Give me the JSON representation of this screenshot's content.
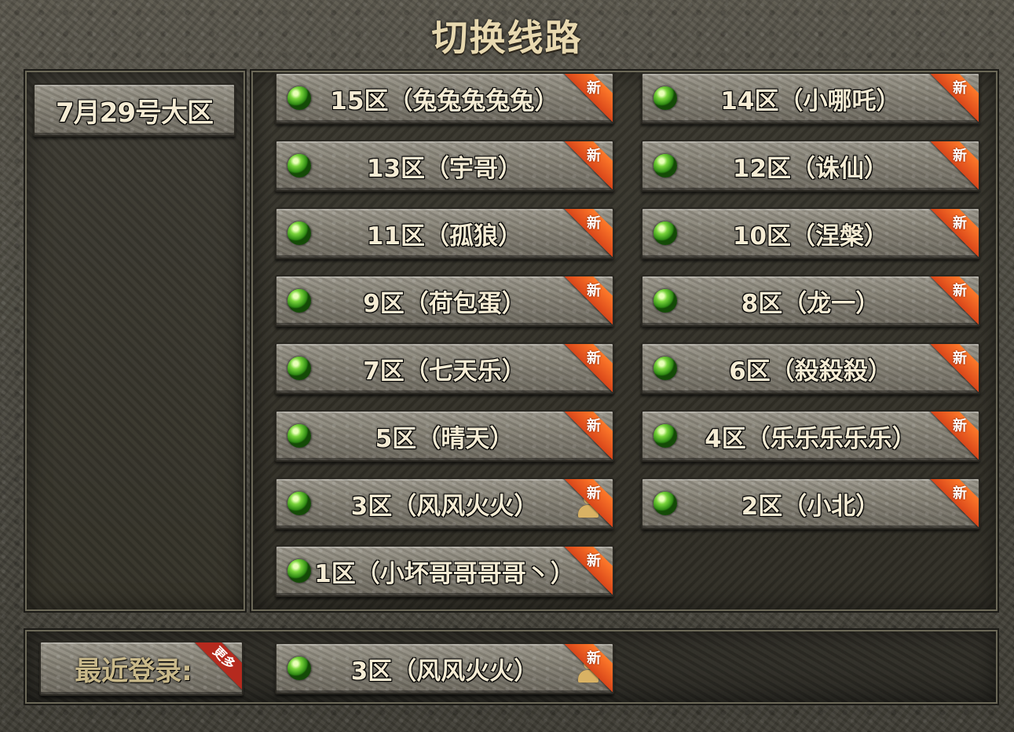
{
  "window": {
    "title": "切换线路"
  },
  "region_button": {
    "label": "7月29号大区"
  },
  "new_badge": "新",
  "servers": [
    {
      "label": "15区（兔兔兔兔兔）",
      "status": "green-orb-icon",
      "is_new": true,
      "has_character": false
    },
    {
      "label": "14区（小哪吒）",
      "status": "green-orb-icon",
      "is_new": true,
      "has_character": false
    },
    {
      "label": "13区（宇哥）",
      "status": "green-orb-icon",
      "is_new": true,
      "has_character": false
    },
    {
      "label": "12区（诛仙）",
      "status": "green-orb-icon",
      "is_new": true,
      "has_character": false
    },
    {
      "label": "11区（孤狼）",
      "status": "green-orb-icon",
      "is_new": true,
      "has_character": false
    },
    {
      "label": "10区（涅槃）",
      "status": "green-orb-icon",
      "is_new": true,
      "has_character": false
    },
    {
      "label": "9区（荷包蛋）",
      "status": "green-orb-icon",
      "is_new": true,
      "has_character": false
    },
    {
      "label": "8区（龙一）",
      "status": "green-orb-icon",
      "is_new": true,
      "has_character": false
    },
    {
      "label": "7区（七天乐）",
      "status": "green-orb-icon",
      "is_new": true,
      "has_character": false
    },
    {
      "label": "6区（殺殺殺）",
      "status": "green-orb-icon",
      "is_new": true,
      "has_character": false
    },
    {
      "label": "5区（晴天）",
      "status": "green-orb-icon",
      "is_new": true,
      "has_character": false
    },
    {
      "label": "4区（乐乐乐乐乐）",
      "status": "green-orb-icon",
      "is_new": true,
      "has_character": false
    },
    {
      "label": "3区（风风火火）",
      "status": "green-orb-icon",
      "is_new": true,
      "has_character": true
    },
    {
      "label": "2区（小北）",
      "status": "green-orb-icon",
      "is_new": true,
      "has_character": false
    },
    {
      "label": "1区（小坏哥哥哥哥丶）",
      "status": "green-orb-icon",
      "is_new": true,
      "has_character": false
    }
  ],
  "recent": {
    "label": "最近登录:",
    "more_badge": "更多",
    "server": {
      "label": "3区（风风火火）",
      "status": "green-orb-icon",
      "is_new": true,
      "has_character": true
    }
  },
  "colors": {
    "status_online": "#5cc22a",
    "new_ribbon": "#e8571f",
    "more_ribbon": "#b52a1e",
    "title_text": "#e8d9b0"
  }
}
